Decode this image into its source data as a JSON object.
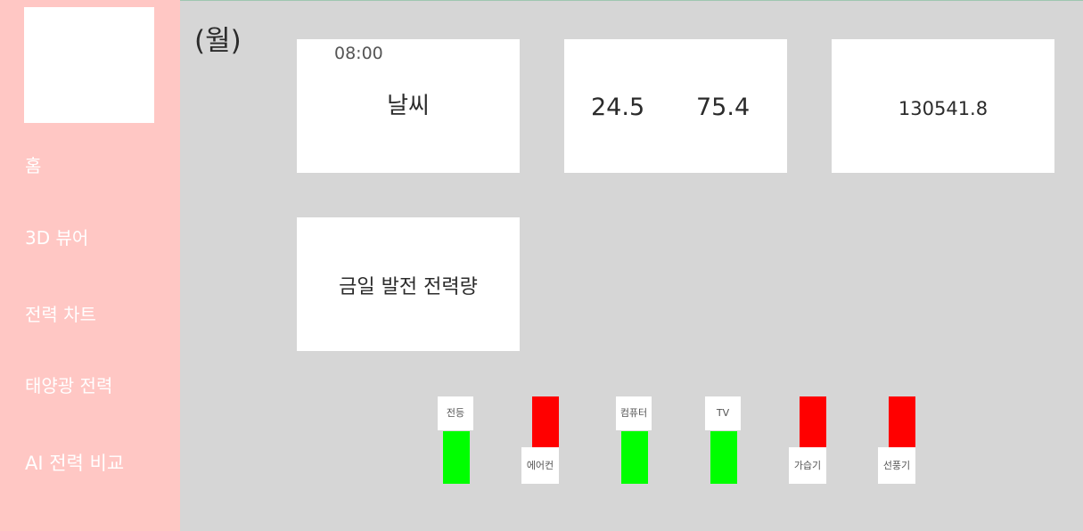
{
  "sidebar": {
    "items": [
      {
        "label": "홈"
      },
      {
        "label": "3D 뷰어"
      },
      {
        "label": "전력 차트"
      },
      {
        "label": "태양광 전력"
      },
      {
        "label": "AI 전력 비교"
      }
    ]
  },
  "header": {
    "day": "(월)"
  },
  "cards": {
    "weather": {
      "time": "08:00",
      "label": "날씨"
    },
    "climate": {
      "temperature": "24.5",
      "humidity": "75.4"
    },
    "total": {
      "value": "130541.8"
    },
    "today_generation": {
      "label": "금일 발전 전력량"
    }
  },
  "devices": [
    {
      "label": "전등",
      "status": "on"
    },
    {
      "label": "에어컨",
      "status": "off"
    },
    {
      "label": "컴퓨터",
      "status": "on"
    },
    {
      "label": "TV",
      "status": "on"
    },
    {
      "label": "가습기",
      "status": "off"
    },
    {
      "label": "선풍기",
      "status": "off"
    }
  ],
  "colors": {
    "sidebar": "#ffc7c4",
    "background": "#d6d6d6",
    "device_on": "#00ff00",
    "device_off": "#ff0000"
  }
}
